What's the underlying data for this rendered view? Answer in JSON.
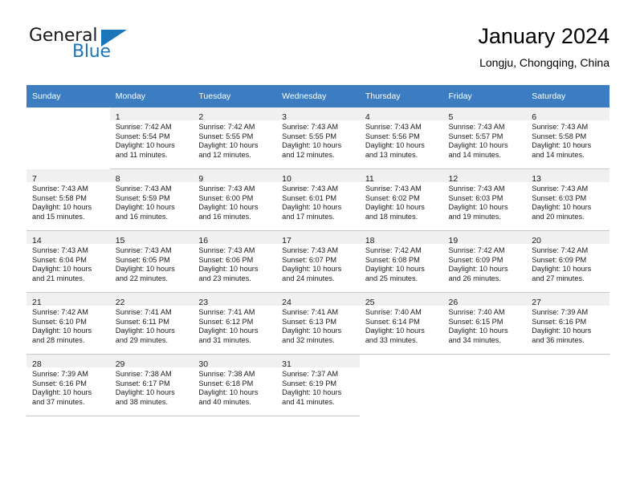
{
  "brand": {
    "name_part1": "General",
    "name_part2": "Blue",
    "flag_icon": "blue-triangle-flag",
    "accent_color": "#1b75bb"
  },
  "header": {
    "title": "January 2024",
    "location": "Longju, Chongqing, China"
  },
  "theme": {
    "header_row_bg": "#3b7dc0",
    "day_number_bg": "#f0f0f0",
    "grid_line": "#c8c8c8",
    "text": "#1a1a1a"
  },
  "weekday_headers": [
    "Sunday",
    "Monday",
    "Tuesday",
    "Wednesday",
    "Thursday",
    "Friday",
    "Saturday"
  ],
  "weeks": [
    [
      {
        "blank": true
      },
      {
        "day": "1",
        "sunrise": "Sunrise: 7:42 AM",
        "sunset": "Sunset: 5:54 PM",
        "daylight_1": "Daylight: 10 hours",
        "daylight_2": "and 11 minutes."
      },
      {
        "day": "2",
        "sunrise": "Sunrise: 7:42 AM",
        "sunset": "Sunset: 5:55 PM",
        "daylight_1": "Daylight: 10 hours",
        "daylight_2": "and 12 minutes."
      },
      {
        "day": "3",
        "sunrise": "Sunrise: 7:43 AM",
        "sunset": "Sunset: 5:55 PM",
        "daylight_1": "Daylight: 10 hours",
        "daylight_2": "and 12 minutes."
      },
      {
        "day": "4",
        "sunrise": "Sunrise: 7:43 AM",
        "sunset": "Sunset: 5:56 PM",
        "daylight_1": "Daylight: 10 hours",
        "daylight_2": "and 13 minutes."
      },
      {
        "day": "5",
        "sunrise": "Sunrise: 7:43 AM",
        "sunset": "Sunset: 5:57 PM",
        "daylight_1": "Daylight: 10 hours",
        "daylight_2": "and 14 minutes."
      },
      {
        "day": "6",
        "sunrise": "Sunrise: 7:43 AM",
        "sunset": "Sunset: 5:58 PM",
        "daylight_1": "Daylight: 10 hours",
        "daylight_2": "and 14 minutes."
      }
    ],
    [
      {
        "day": "7",
        "sunrise": "Sunrise: 7:43 AM",
        "sunset": "Sunset: 5:58 PM",
        "daylight_1": "Daylight: 10 hours",
        "daylight_2": "and 15 minutes."
      },
      {
        "day": "8",
        "sunrise": "Sunrise: 7:43 AM",
        "sunset": "Sunset: 5:59 PM",
        "daylight_1": "Daylight: 10 hours",
        "daylight_2": "and 16 minutes."
      },
      {
        "day": "9",
        "sunrise": "Sunrise: 7:43 AM",
        "sunset": "Sunset: 6:00 PM",
        "daylight_1": "Daylight: 10 hours",
        "daylight_2": "and 16 minutes."
      },
      {
        "day": "10",
        "sunrise": "Sunrise: 7:43 AM",
        "sunset": "Sunset: 6:01 PM",
        "daylight_1": "Daylight: 10 hours",
        "daylight_2": "and 17 minutes."
      },
      {
        "day": "11",
        "sunrise": "Sunrise: 7:43 AM",
        "sunset": "Sunset: 6:02 PM",
        "daylight_1": "Daylight: 10 hours",
        "daylight_2": "and 18 minutes."
      },
      {
        "day": "12",
        "sunrise": "Sunrise: 7:43 AM",
        "sunset": "Sunset: 6:03 PM",
        "daylight_1": "Daylight: 10 hours",
        "daylight_2": "and 19 minutes."
      },
      {
        "day": "13",
        "sunrise": "Sunrise: 7:43 AM",
        "sunset": "Sunset: 6:03 PM",
        "daylight_1": "Daylight: 10 hours",
        "daylight_2": "and 20 minutes."
      }
    ],
    [
      {
        "day": "14",
        "sunrise": "Sunrise: 7:43 AM",
        "sunset": "Sunset: 6:04 PM",
        "daylight_1": "Daylight: 10 hours",
        "daylight_2": "and 21 minutes."
      },
      {
        "day": "15",
        "sunrise": "Sunrise: 7:43 AM",
        "sunset": "Sunset: 6:05 PM",
        "daylight_1": "Daylight: 10 hours",
        "daylight_2": "and 22 minutes."
      },
      {
        "day": "16",
        "sunrise": "Sunrise: 7:43 AM",
        "sunset": "Sunset: 6:06 PM",
        "daylight_1": "Daylight: 10 hours",
        "daylight_2": "and 23 minutes."
      },
      {
        "day": "17",
        "sunrise": "Sunrise: 7:43 AM",
        "sunset": "Sunset: 6:07 PM",
        "daylight_1": "Daylight: 10 hours",
        "daylight_2": "and 24 minutes."
      },
      {
        "day": "18",
        "sunrise": "Sunrise: 7:42 AM",
        "sunset": "Sunset: 6:08 PM",
        "daylight_1": "Daylight: 10 hours",
        "daylight_2": "and 25 minutes."
      },
      {
        "day": "19",
        "sunrise": "Sunrise: 7:42 AM",
        "sunset": "Sunset: 6:09 PM",
        "daylight_1": "Daylight: 10 hours",
        "daylight_2": "and 26 minutes."
      },
      {
        "day": "20",
        "sunrise": "Sunrise: 7:42 AM",
        "sunset": "Sunset: 6:09 PM",
        "daylight_1": "Daylight: 10 hours",
        "daylight_2": "and 27 minutes."
      }
    ],
    [
      {
        "day": "21",
        "sunrise": "Sunrise: 7:42 AM",
        "sunset": "Sunset: 6:10 PM",
        "daylight_1": "Daylight: 10 hours",
        "daylight_2": "and 28 minutes."
      },
      {
        "day": "22",
        "sunrise": "Sunrise: 7:41 AM",
        "sunset": "Sunset: 6:11 PM",
        "daylight_1": "Daylight: 10 hours",
        "daylight_2": "and 29 minutes."
      },
      {
        "day": "23",
        "sunrise": "Sunrise: 7:41 AM",
        "sunset": "Sunset: 6:12 PM",
        "daylight_1": "Daylight: 10 hours",
        "daylight_2": "and 31 minutes."
      },
      {
        "day": "24",
        "sunrise": "Sunrise: 7:41 AM",
        "sunset": "Sunset: 6:13 PM",
        "daylight_1": "Daylight: 10 hours",
        "daylight_2": "and 32 minutes."
      },
      {
        "day": "25",
        "sunrise": "Sunrise: 7:40 AM",
        "sunset": "Sunset: 6:14 PM",
        "daylight_1": "Daylight: 10 hours",
        "daylight_2": "and 33 minutes."
      },
      {
        "day": "26",
        "sunrise": "Sunrise: 7:40 AM",
        "sunset": "Sunset: 6:15 PM",
        "daylight_1": "Daylight: 10 hours",
        "daylight_2": "and 34 minutes."
      },
      {
        "day": "27",
        "sunrise": "Sunrise: 7:39 AM",
        "sunset": "Sunset: 6:16 PM",
        "daylight_1": "Daylight: 10 hours",
        "daylight_2": "and 36 minutes."
      }
    ],
    [
      {
        "day": "28",
        "sunrise": "Sunrise: 7:39 AM",
        "sunset": "Sunset: 6:16 PM",
        "daylight_1": "Daylight: 10 hours",
        "daylight_2": "and 37 minutes."
      },
      {
        "day": "29",
        "sunrise": "Sunrise: 7:38 AM",
        "sunset": "Sunset: 6:17 PM",
        "daylight_1": "Daylight: 10 hours",
        "daylight_2": "and 38 minutes."
      },
      {
        "day": "30",
        "sunrise": "Sunrise: 7:38 AM",
        "sunset": "Sunset: 6:18 PM",
        "daylight_1": "Daylight: 10 hours",
        "daylight_2": "and 40 minutes."
      },
      {
        "day": "31",
        "sunrise": "Sunrise: 7:37 AM",
        "sunset": "Sunset: 6:19 PM",
        "daylight_1": "Daylight: 10 hours",
        "daylight_2": "and 41 minutes."
      },
      {
        "blank": true
      },
      {
        "blank": true
      },
      {
        "blank": true
      }
    ]
  ]
}
